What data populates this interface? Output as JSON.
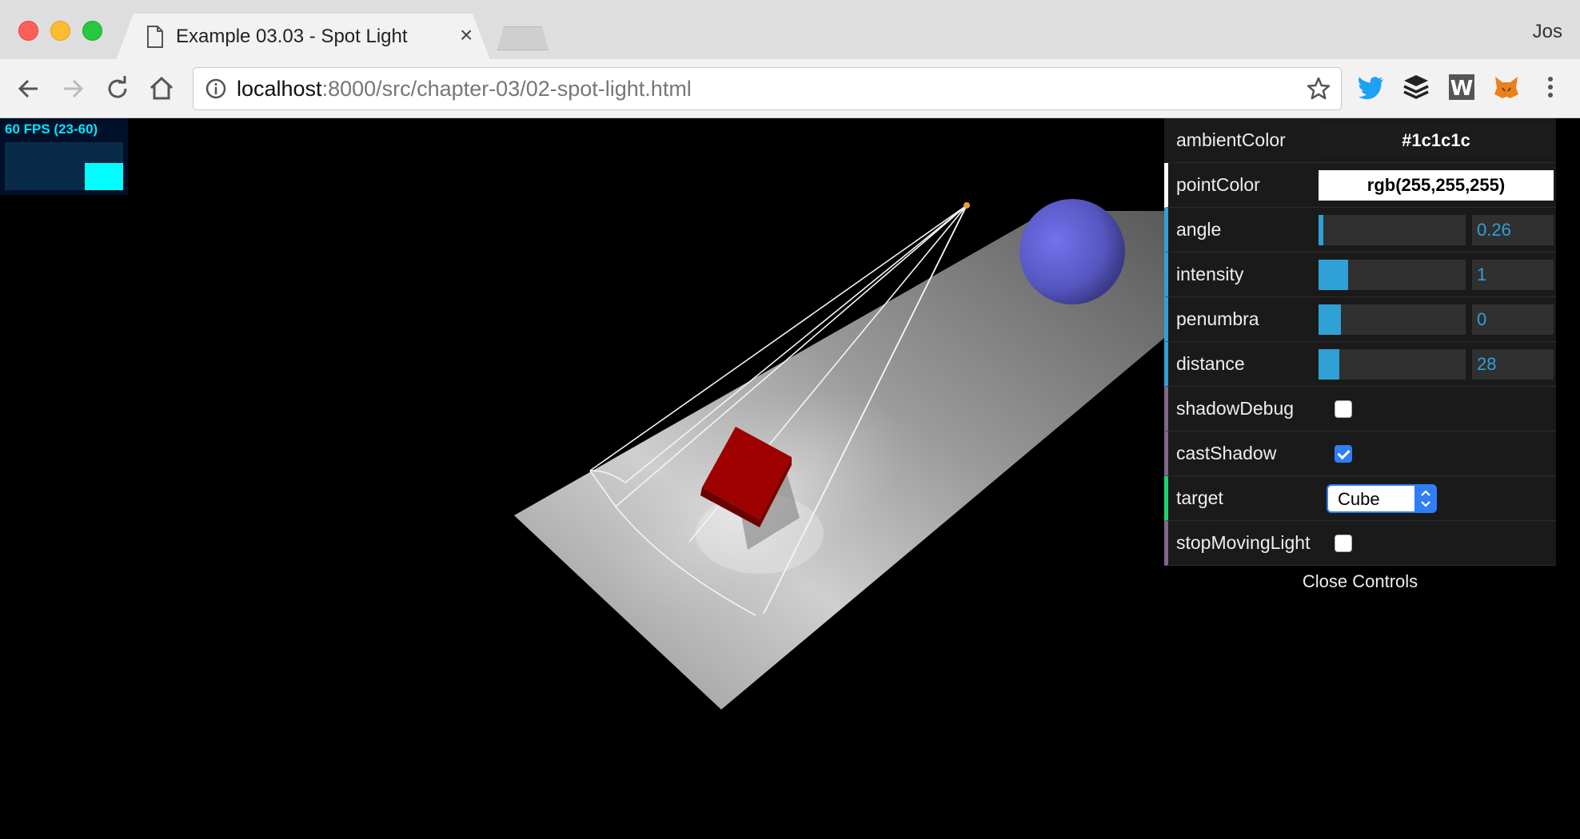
{
  "browser": {
    "tab_title": "Example 03.03 - Spot Light",
    "tab_close": "×",
    "profile_name": "Jos",
    "url_host": "localhost",
    "url_path": ":8000/src/chapter-03/02-spot-light.html"
  },
  "stats": {
    "fps_text": "60 FPS (23-60)"
  },
  "gui": {
    "ambientColor": {
      "label": "ambientColor",
      "value": "#1c1c1c"
    },
    "pointColor": {
      "label": "pointColor",
      "value": "rgb(255,255,255)"
    },
    "angle": {
      "label": "angle",
      "value": "0.26",
      "fraction": 0.03
    },
    "intensity": {
      "label": "intensity",
      "value": "1",
      "fraction": 0.2
    },
    "penumbra": {
      "label": "penumbra",
      "value": "0",
      "fraction": 0.15
    },
    "distance": {
      "label": "distance",
      "value": "28",
      "fraction": 0.14
    },
    "shadowDebug": {
      "label": "shadowDebug",
      "checked": false
    },
    "castShadow": {
      "label": "castShadow",
      "checked": true
    },
    "target": {
      "label": "target",
      "value": "Cube"
    },
    "stopMovingLight": {
      "label": "stopMovingLight",
      "checked": false
    },
    "close_label": "Close Controls"
  },
  "colors": {
    "slider_accent": "#2fa1d6",
    "cube": "#9e0000",
    "sphere": "#6b6bd8",
    "stats_text": "#00e5ff"
  }
}
